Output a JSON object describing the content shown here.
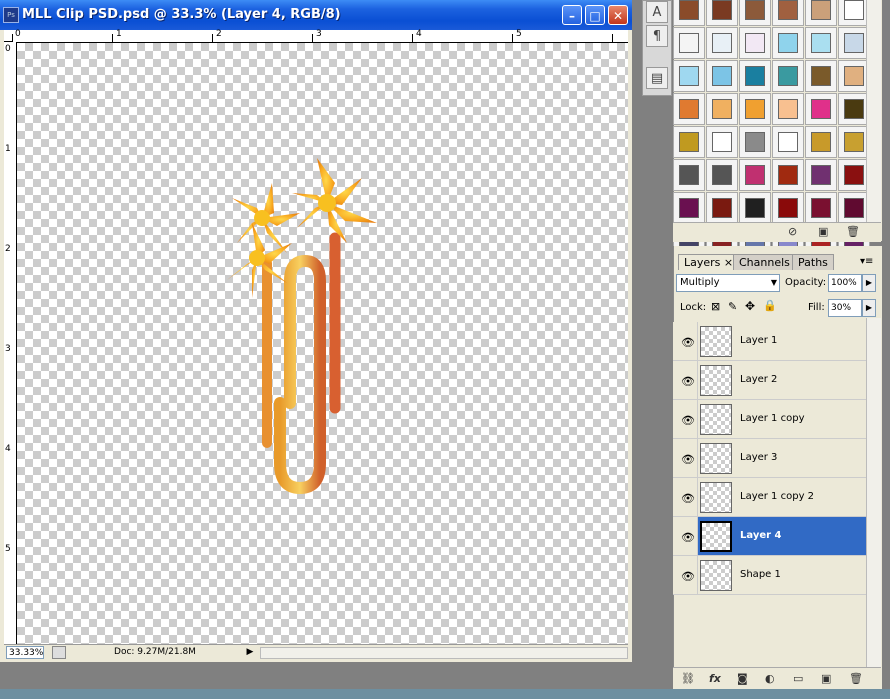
{
  "window": {
    "title": "MLL Clip PSD.psd @ 33.3% (Layer 4, RGB/8)",
    "app_icon": "Ps",
    "minimize": "–",
    "maximize": "□",
    "close": "✕"
  },
  "rulers": {
    "top": [
      "0",
      "1",
      "2",
      "3",
      "4",
      "5"
    ],
    "left": [
      "0",
      "1",
      "2",
      "3",
      "4",
      "5"
    ]
  },
  "status": {
    "zoom": "33.33%",
    "doc": "Doc: 9.27M/21.8M",
    "arrow": "▶"
  },
  "tools": {
    "type": "A",
    "paragraph": "¶",
    "notes": "▤"
  },
  "layers_panel": {
    "tabs": [
      "Layers",
      "Channels",
      "Paths"
    ],
    "tab_close": "×",
    "menu": "▾≡",
    "blend_mode": "Multiply",
    "opacity_label": "Opacity:",
    "opacity": "100%",
    "lock_label": "Lock:",
    "fill_label": "Fill:",
    "fill": "30%",
    "layers": [
      {
        "name": "Layer 1",
        "selected": false
      },
      {
        "name": "Layer 2",
        "selected": false
      },
      {
        "name": "Layer 1 copy",
        "selected": false
      },
      {
        "name": "Layer 3",
        "selected": false
      },
      {
        "name": "Layer 1 copy 2",
        "selected": false
      },
      {
        "name": "Layer 4",
        "selected": true
      },
      {
        "name": "Shape 1",
        "selected": false
      }
    ]
  },
  "styles_colors": [
    [
      "#8a4b2a",
      "#7a3a22",
      "#8c5a3a",
      "#a06040",
      "#caa07a",
      "#ffffff"
    ],
    [
      "#f4f4f4",
      "#e8f0f6",
      "#f2e8f4",
      "#8fd3ec",
      "#aadff0",
      "#c8d8e8"
    ],
    [
      "#9fd8f0",
      "#7cc4e6",
      "#1a7fa0",
      "#3a9aa0",
      "#7a5a2a",
      "#e0b080"
    ],
    [
      "#e07a30",
      "#f0b060",
      "#f0a030",
      "#f8c090",
      "#e0308a",
      "#4a3a10"
    ],
    [
      "#c09a20",
      "#ffffff",
      "#8a8a8a",
      "#ffffff",
      "#c89a2a",
      "#c8a030"
    ],
    [
      "#555555",
      "#555555",
      "#c03070",
      "#a02a10",
      "#703070",
      "#8a1010"
    ],
    [
      "#6a1050",
      "#7a1a10",
      "#202020",
      "#8a0a0a",
      "#7a1030",
      "#600a30"
    ],
    [
      "#444466",
      "#882222",
      "#6677aa",
      "#8888cc",
      "#aa2222",
      "#662266"
    ]
  ]
}
